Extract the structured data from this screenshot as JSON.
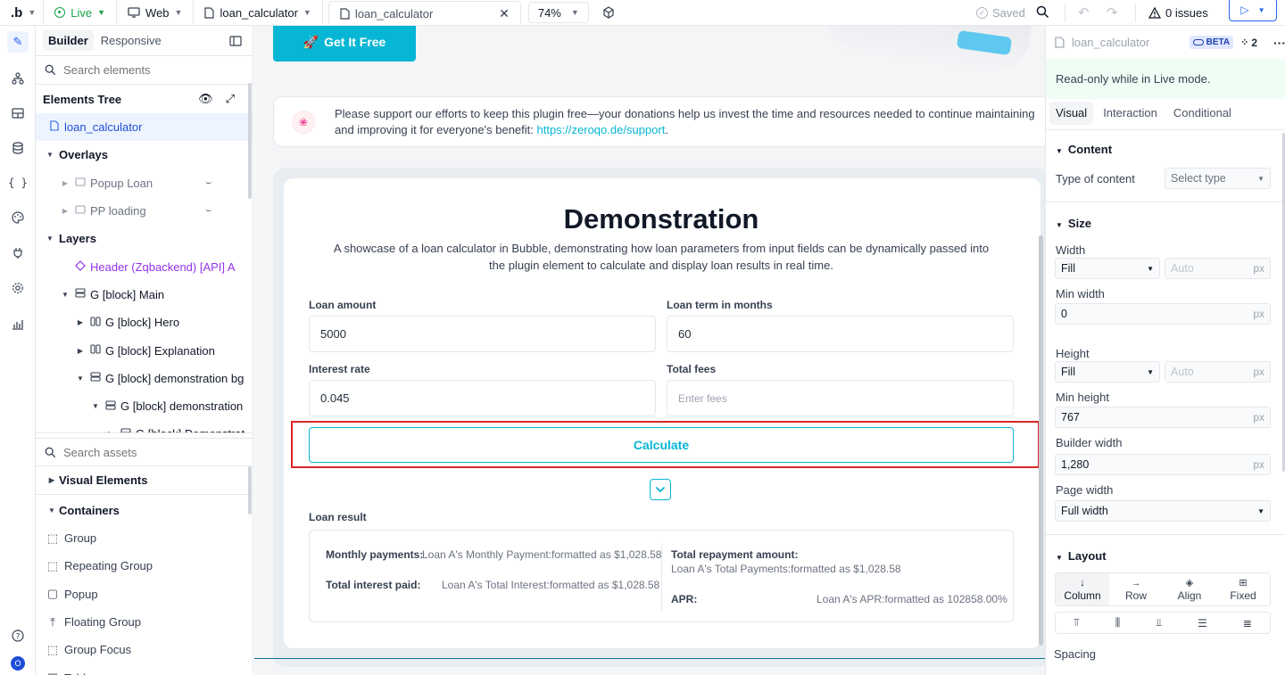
{
  "topbar": {
    "logo": ".b",
    "mode": "Live",
    "platform": "Web",
    "page_name": "loan_calculator",
    "tab_name": "loan_calculator",
    "zoom": "74%",
    "saved": "Saved",
    "issues": "0 issues"
  },
  "left_panel": {
    "tab_builder": "Builder",
    "tab_responsive": "Responsive",
    "search_elements_placeholder": "Search elements",
    "elements_tree_title": "Elements Tree",
    "tree": [
      {
        "label": "loan_calculator",
        "depth": 0,
        "icon": "page",
        "toggle": "",
        "selected": true
      },
      {
        "label": "Overlays",
        "depth": 0,
        "icon": "",
        "toggle": "▼",
        "bold": true
      },
      {
        "label": "Popup Loan",
        "depth": 1,
        "icon": "popup",
        "toggle": "▶",
        "muted": true,
        "hidden": true
      },
      {
        "label": "PP loading",
        "depth": 1,
        "icon": "popup",
        "toggle": "▶",
        "muted": true,
        "hidden": true
      },
      {
        "label": "Layers",
        "depth": 0,
        "icon": "",
        "toggle": "▼",
        "bold": true
      },
      {
        "label": "Header (Zqbackend) [API] A",
        "depth": 1,
        "icon": "reusable",
        "toggle": "",
        "purple": true
      },
      {
        "label": "G [block] Main",
        "depth": 1,
        "icon": "group-rows",
        "toggle": "▼"
      },
      {
        "label": "G [block] Hero",
        "depth": 2,
        "icon": "group-cols",
        "toggle": "▶"
      },
      {
        "label": "G [block] Explanation",
        "depth": 2,
        "icon": "group-cols",
        "toggle": "▶"
      },
      {
        "label": "G [block] demonstration bg",
        "depth": 2,
        "icon": "group-rows",
        "toggle": "▼"
      },
      {
        "label": "G [block] demonstration",
        "depth": 3,
        "icon": "group-rows",
        "toggle": "▼"
      },
      {
        "label": "G [block] Demonstrat",
        "depth": 4,
        "icon": "group-rows",
        "toggle": "▶"
      }
    ],
    "search_assets_placeholder": "Search assets",
    "visual_elements": "Visual Elements",
    "containers": "Containers",
    "container_items": [
      "Group",
      "Repeating Group",
      "Popup",
      "Floating Group",
      "Group Focus",
      "Table"
    ]
  },
  "canvas": {
    "hero_button": "Get It Free",
    "donation_text": "Please support our efforts to keep this plugin free—your donations help us invest the time and resources needed to continue maintaining and improving it for everyone's benefit: ",
    "donation_link": "https://zeroqo.de/support",
    "donation_end": ".",
    "title": "Demonstration",
    "subtitle": "A showcase of a loan calculator in Bubble, demonstrating how loan parameters from input fields can be dynamically passed into the plugin element to calculate and display loan results in real time.",
    "loan_amount_label": "Loan amount",
    "loan_amount_value": "5000",
    "loan_term_label": "Loan term in months",
    "loan_term_value": "60",
    "interest_rate_label": "Interest rate",
    "interest_rate_value": "0.045",
    "total_fees_label": "Total fees",
    "total_fees_placeholder": "Enter fees",
    "calculate_button": "Calculate",
    "loan_result_label": "Loan result",
    "monthly_payments_label": "Monthly payments:",
    "monthly_payments_value": "Loan A's Monthly Payment:formatted as $1,028.58",
    "total_interest_label": "Total interest paid:",
    "total_interest_value": "Loan A's Total Interest:formatted as $1,028.58",
    "total_repayment_label": "Total repayment amount:",
    "total_repayment_value": "Loan A's Total Payments:formatted as $1,028.58",
    "apr_label": "APR:",
    "apr_value": "Loan A's APR:formatted as 102858.00%"
  },
  "right_panel": {
    "element_name": "loan_calculator",
    "beta": "BETA",
    "count": "2",
    "readonly_notice": "Read-only while in Live mode.",
    "tab_visual": "Visual",
    "tab_interaction": "Interaction",
    "tab_conditional": "Conditional",
    "content_section": "Content",
    "type_of_content_label": "Type of content",
    "type_of_content_value": "Select type",
    "size_section": "Size",
    "width_label": "Width",
    "width_value": "Fill",
    "width_auto": "Auto",
    "min_width_label": "Min width",
    "min_width_value": "0",
    "height_label": "Height",
    "height_value": "Fill",
    "height_auto": "Auto",
    "min_height_label": "Min height",
    "min_height_value": "767",
    "builder_width_label": "Builder width",
    "builder_width_value": "1,280",
    "page_width_label": "Page width",
    "page_width_value": "Full width",
    "unit": "px",
    "layout_section": "Layout",
    "layout_column": "Column",
    "layout_row": "Row",
    "layout_align": "Align",
    "layout_fixed": "Fixed",
    "spacing_label": "Spacing"
  },
  "colors": {
    "accent": "#06b6d4",
    "highlight_box": "#dc2626",
    "purple": "#9333ea",
    "selection_bg": "#eef4ff",
    "readonly_bg": "#f0fdf4"
  }
}
